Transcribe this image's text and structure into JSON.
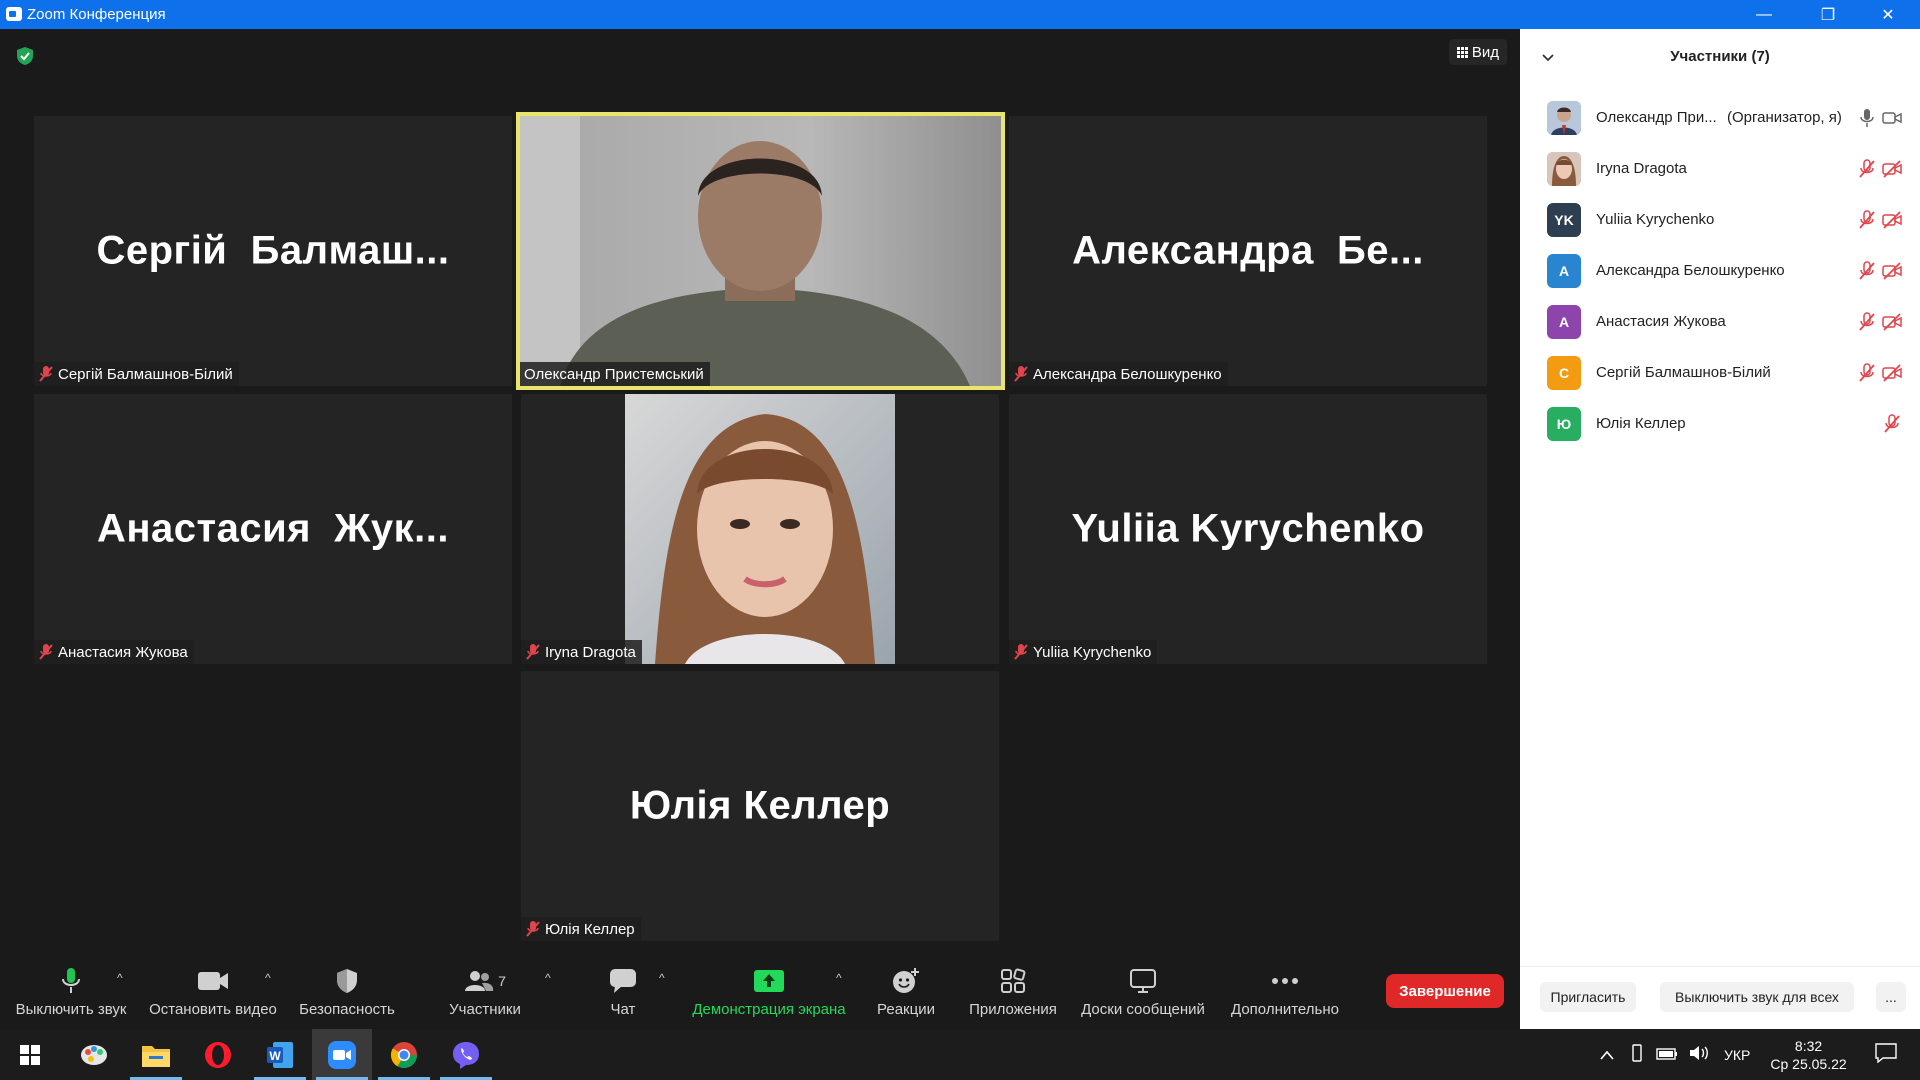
{
  "window": {
    "title": "Zoom Конференция",
    "minimize": "—",
    "maximize": "❐",
    "close": "✕"
  },
  "view_label": "Вид",
  "tiles": [
    {
      "big": "Сергій  Балмаш...",
      "label": "Сергій Балмашнов-Білий"
    },
    {
      "big": "",
      "label": "Олександр Пристемський"
    },
    {
      "big": "Александра  Бе...",
      "label": "Александра Белошкуренко"
    },
    {
      "big": "Анастасия  Жук...",
      "label": "Анастасия Жукова"
    },
    {
      "big": "",
      "label": "Iryna Dragota"
    },
    {
      "big": "Yuliia Kyrychenko",
      "label": "Yuliia Kyrychenko"
    },
    {
      "big": "Юлія Келлер",
      "label": "Юлія Келлер"
    }
  ],
  "sidebar": {
    "title": "Участники (7)",
    "participants": [
      {
        "name": "Олександр При...",
        "role": "(Организатор, я)",
        "initials": "",
        "color": "#8aa4c8"
      },
      {
        "name": "Iryna Dragota",
        "role": "",
        "initials": "",
        "color": "#c79a86"
      },
      {
        "name": "Yuliia Kyrychenko",
        "role": "",
        "initials": "YK",
        "color": "#2d3e50"
      },
      {
        "name": "Александра Белошкуренко",
        "role": "",
        "initials": "A",
        "color": "#2a85d0"
      },
      {
        "name": "Анастасия Жукова",
        "role": "",
        "initials": "A",
        "color": "#8e44ad"
      },
      {
        "name": "Сергій Балмашнов-Білий",
        "role": "",
        "initials": "C",
        "color": "#f39c12"
      },
      {
        "name": "Юлія Келлер",
        "role": "",
        "initials": "Ю",
        "color": "#27ae60"
      }
    ],
    "invite": "Пригласить",
    "mute_all": "Выключить звук для всех",
    "more": "..."
  },
  "toolbar": {
    "mute": "Выключить звук",
    "video": "Остановить видео",
    "security": "Безопасность",
    "participants": "Участники",
    "participants_count": "7",
    "chat": "Чат",
    "share": "Демонстрация экрана",
    "reactions": "Реакции",
    "apps": "Приложения",
    "boards": "Доски сообщений",
    "more": "Дополнительно",
    "end": "Завершение"
  },
  "taskbar": {
    "lang": "УКР",
    "time": "8:32",
    "date": "Ср 25.05.22"
  },
  "colors": {
    "accent": "#0e71eb",
    "end": "#e02828",
    "share": "#23d959",
    "muted": "#e0454d",
    "speaker": "#e9e46b"
  }
}
